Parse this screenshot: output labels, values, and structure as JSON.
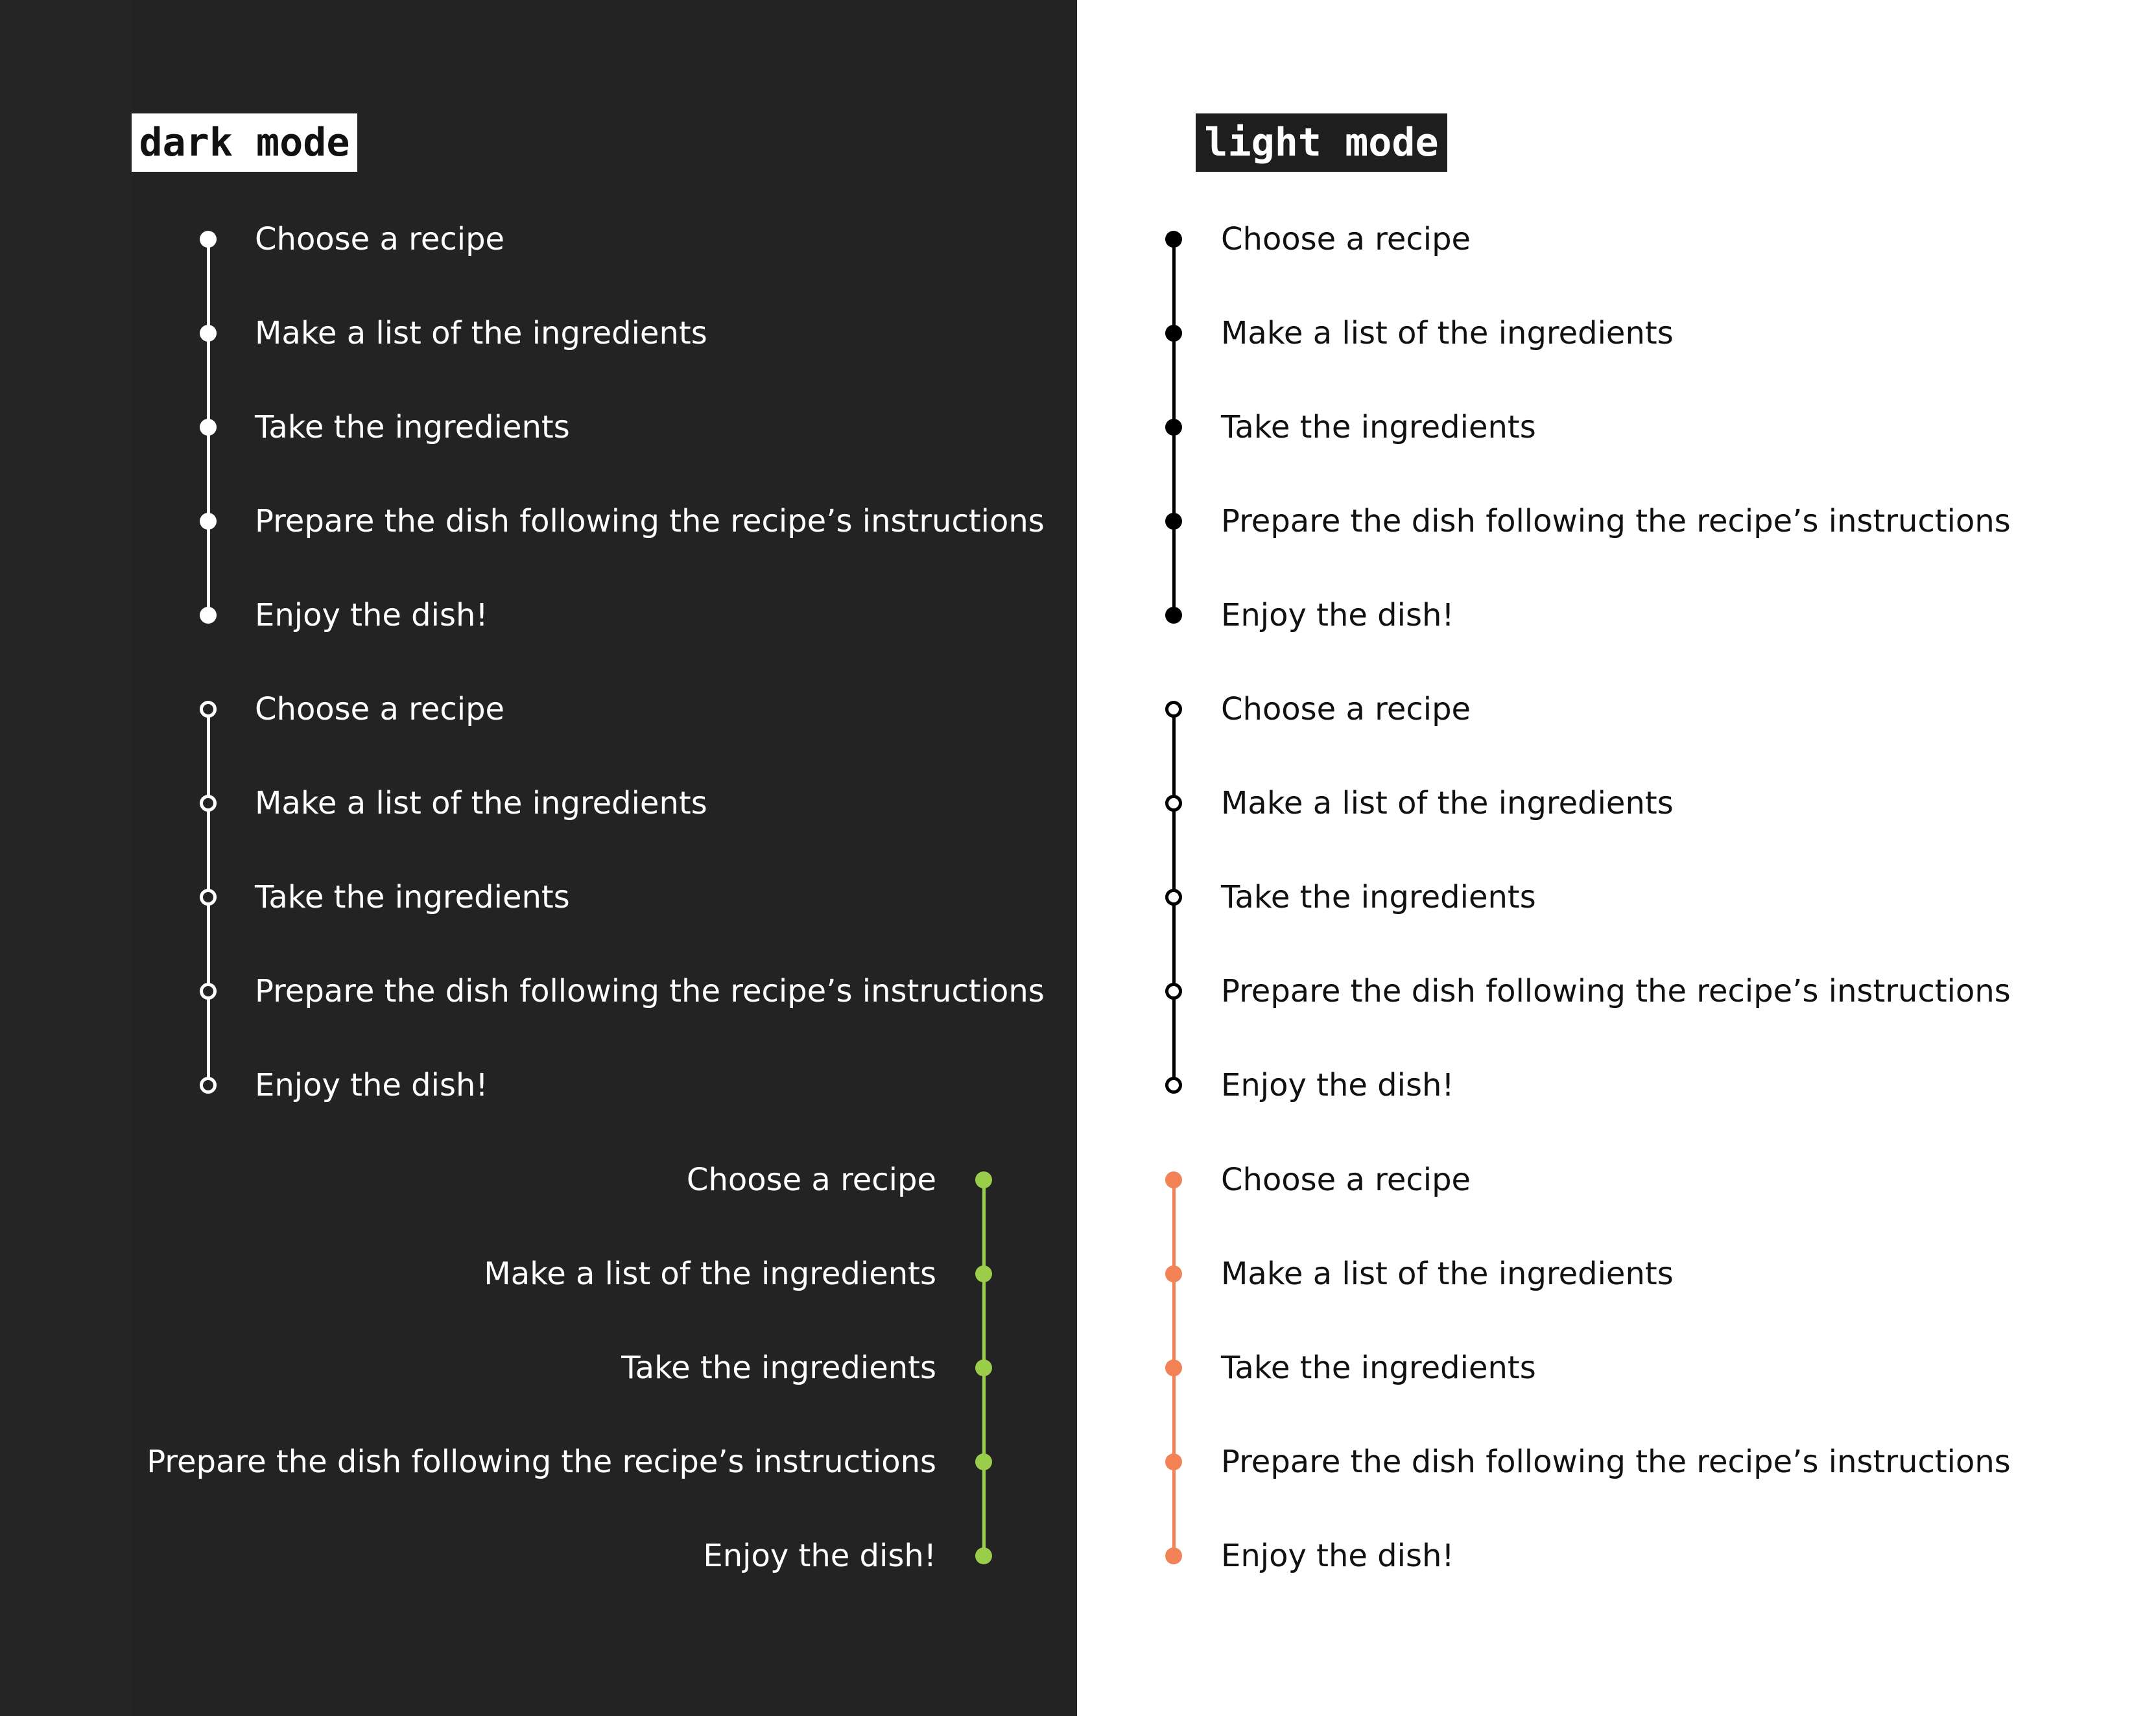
{
  "dark_mode": {
    "label": "dark mode",
    "timelines": [
      {
        "variant": "filled",
        "align": "left",
        "line_color": "#ffffff",
        "dot_color": "#ffffff",
        "text_color": "#ffffff",
        "steps": [
          "Choose a recipe",
          "Make a list of the ingredients",
          "Take the ingredients",
          "Prepare the dish following the recipe’s instructions",
          "Enjoy the dish!"
        ]
      },
      {
        "variant": "outlined",
        "align": "left",
        "line_color": "#ffffff",
        "dot_color": "#ffffff",
        "dot_fill": "#232323",
        "text_color": "#ffffff",
        "steps": [
          "Choose a recipe",
          "Make a list of the ingredients",
          "Take the ingredients",
          "Prepare the dish following the recipe’s instructions",
          "Enjoy the dish!"
        ]
      },
      {
        "variant": "filled",
        "align": "right",
        "line_color": "#9acd4a",
        "dot_color": "#9acd4a",
        "text_color": "#ffffff",
        "steps": [
          "Choose a recipe",
          "Make a list of the ingredients",
          "Take the ingredients",
          "Prepare the dish following the recipe’s instructions",
          "Enjoy the dish!"
        ]
      }
    ]
  },
  "light_mode": {
    "label": "light mode",
    "timelines": [
      {
        "variant": "filled",
        "align": "left",
        "line_color": "#000000",
        "dot_color": "#000000",
        "text_color": "#111111",
        "steps": [
          "Choose a recipe",
          "Make a list of the ingredients",
          "Take the ingredients",
          "Prepare the dish following the recipe’s instructions",
          "Enjoy the dish!"
        ]
      },
      {
        "variant": "outlined",
        "align": "left",
        "line_color": "#000000",
        "dot_color": "#000000",
        "dot_fill": "#ffffff",
        "text_color": "#111111",
        "steps": [
          "Choose a recipe",
          "Make a list of the ingredients",
          "Take the ingredients",
          "Prepare the dish following the recipe’s instructions",
          "Enjoy the dish!"
        ]
      },
      {
        "variant": "filled",
        "align": "left",
        "line_color": "#f38257",
        "dot_color": "#f38257",
        "text_color": "#111111",
        "steps": [
          "Choose a recipe",
          "Make a list of the ingredients",
          "Take the ingredients",
          "Prepare the dish following the recipe’s instructions",
          "Enjoy the dish!"
        ]
      }
    ]
  }
}
